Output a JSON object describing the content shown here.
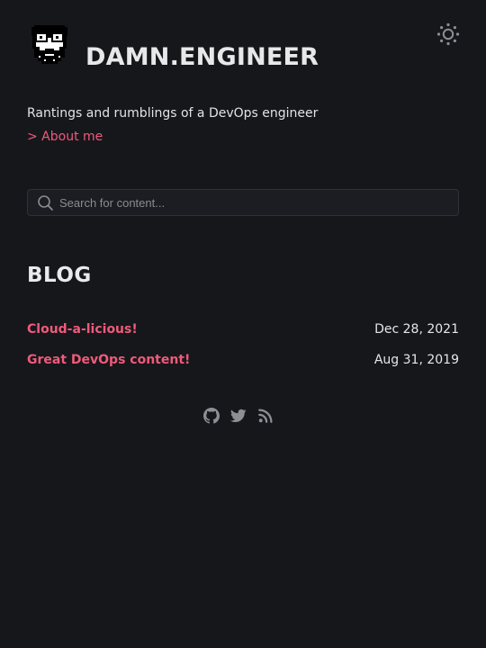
{
  "header": {
    "site_title": "DAMN.ENGINEER",
    "logo_icon": "bearded-face-glasses-icon",
    "theme_toggle_icon": "sun-icon",
    "tagline": "Rantings and rumblings of a DevOps engineer",
    "about_link": "> About me"
  },
  "search": {
    "placeholder": "Search for content..."
  },
  "blog": {
    "heading": "BLOG",
    "posts": [
      {
        "title": "Cloud-a-licious!",
        "date": "Dec 28, 2021"
      },
      {
        "title": "Great DevOps content!",
        "date": "Aug 31, 2019"
      }
    ]
  },
  "footer": {
    "social_icons": [
      "github-icon",
      "twitter-icon",
      "rss-icon"
    ]
  },
  "colors": {
    "background": "#16171b",
    "accent": "#ef5a7a",
    "text": "#e6e6e8",
    "muted": "#8a8b91"
  }
}
